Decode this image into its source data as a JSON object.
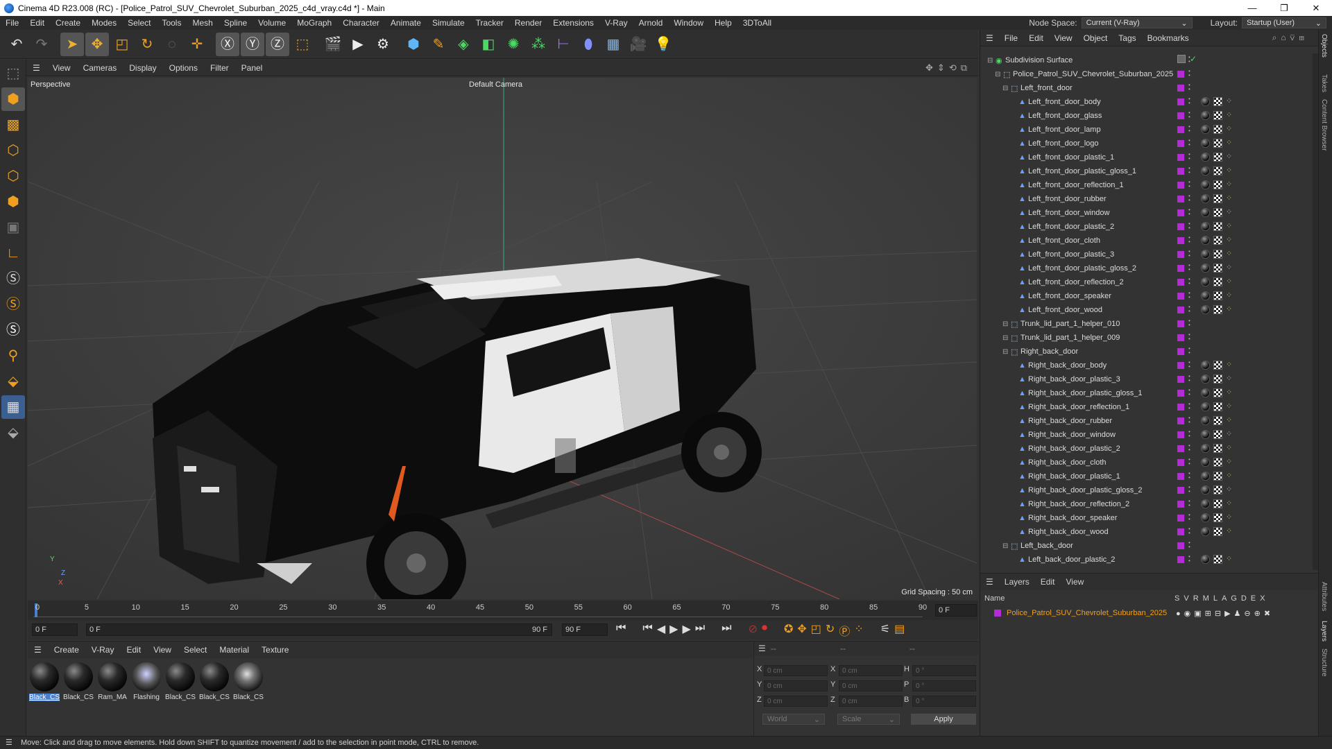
{
  "window": {
    "title": "Cinema 4D R23.008 (RC) - [Police_Patrol_SUV_Chevrolet_Suburban_2025_c4d_vray.c4d *] - Main",
    "minimize": "—",
    "maximize": "❐",
    "close": "✕"
  },
  "menubar": {
    "items": [
      "File",
      "Edit",
      "Create",
      "Modes",
      "Select",
      "Tools",
      "Mesh",
      "Spline",
      "Volume",
      "MoGraph",
      "Character",
      "Animate",
      "Simulate",
      "Tracker",
      "Render",
      "Extensions",
      "V-Ray",
      "Arnold",
      "Window",
      "Help",
      "3DToAll"
    ],
    "node_space_label": "Node Space:",
    "node_space_value": "Current (V-Ray)",
    "layout_label": "Layout:",
    "layout_value": "Startup (User)"
  },
  "viewport": {
    "menu": [
      "View",
      "Cameras",
      "Display",
      "Options",
      "Filter",
      "Panel"
    ],
    "view_name": "Perspective",
    "camera_name": "Default Camera",
    "grid_spacing": "Grid Spacing : 50 cm",
    "axis_y": "Y",
    "axis_z": "Z",
    "axis_x": "X"
  },
  "timeline": {
    "ticks": [
      "0",
      "5",
      "10",
      "15",
      "20",
      "25",
      "30",
      "35",
      "40",
      "45",
      "50",
      "55",
      "60",
      "65",
      "70",
      "75",
      "80",
      "85",
      "90"
    ],
    "current_frame": "0 F",
    "start_field": "0 F",
    "range_start": "0 F",
    "range_end": "90 F",
    "end_field": "90 F"
  },
  "materials": {
    "menu": [
      "Create",
      "V-Ray",
      "Edit",
      "View",
      "Select",
      "Material",
      "Texture"
    ],
    "items": [
      "Black_CS",
      "Black_CS",
      "Ram_MA",
      "Flashing",
      "Black_CS",
      "Black_CS",
      "Black_CS"
    ]
  },
  "coords": {
    "header": [
      "--",
      "--",
      "--"
    ],
    "rows": [
      {
        "a": "X",
        "av": "0 cm",
        "b": "X",
        "bv": "0 cm",
        "c": "H",
        "cv": "0 °"
      },
      {
        "a": "Y",
        "av": "0 cm",
        "b": "Y",
        "bv": "0 cm",
        "c": "P",
        "cv": "0 °"
      },
      {
        "a": "Z",
        "av": "0 cm",
        "b": "Z",
        "bv": "0 cm",
        "c": "B",
        "cv": "0 °"
      }
    ],
    "space": "World",
    "mode": "Scale",
    "apply": "Apply"
  },
  "objects": {
    "menu": [
      "File",
      "Edit",
      "View",
      "Object",
      "Tags",
      "Bookmarks"
    ],
    "rows": [
      {
        "name": "Subdivision Surface",
        "indent": 0,
        "tags": false
      },
      {
        "name": "Police_Patrol_SUV_Chevrolet_Suburban_2025",
        "indent": 1,
        "tags": false
      },
      {
        "name": "Left_front_door",
        "indent": 2,
        "tags": false
      },
      {
        "name": "Left_front_door_body",
        "indent": 3,
        "tags": true
      },
      {
        "name": "Left_front_door_glass",
        "indent": 3,
        "tags": true
      },
      {
        "name": "Left_front_door_lamp",
        "indent": 3,
        "tags": true
      },
      {
        "name": "Left_front_door_logo",
        "indent": 3,
        "tags": true
      },
      {
        "name": "Left_front_door_plastic_1",
        "indent": 3,
        "tags": true
      },
      {
        "name": "Left_front_door_plastic_gloss_1",
        "indent": 3,
        "tags": true
      },
      {
        "name": "Left_front_door_reflection_1",
        "indent": 3,
        "tags": true
      },
      {
        "name": "Left_front_door_rubber",
        "indent": 3,
        "tags": true
      },
      {
        "name": "Left_front_door_window",
        "indent": 3,
        "tags": true
      },
      {
        "name": "Left_front_door_plastic_2",
        "indent": 3,
        "tags": true
      },
      {
        "name": "Left_front_door_cloth",
        "indent": 3,
        "tags": true
      },
      {
        "name": "Left_front_door_plastic_3",
        "indent": 3,
        "tags": true
      },
      {
        "name": "Left_front_door_plastic_gloss_2",
        "indent": 3,
        "tags": true
      },
      {
        "name": "Left_front_door_reflection_2",
        "indent": 3,
        "tags": true
      },
      {
        "name": "Left_front_door_speaker",
        "indent": 3,
        "tags": true
      },
      {
        "name": "Left_front_door_wood",
        "indent": 3,
        "tags": true
      },
      {
        "name": "Trunk_lid_part_1_helper_010",
        "indent": 2,
        "tags": false
      },
      {
        "name": "Trunk_lid_part_1_helper_009",
        "indent": 2,
        "tags": false
      },
      {
        "name": "Right_back_door",
        "indent": 2,
        "tags": false
      },
      {
        "name": "Right_back_door_body",
        "indent": 3,
        "tags": true
      },
      {
        "name": "Right_back_door_plastic_3",
        "indent": 3,
        "tags": true
      },
      {
        "name": "Right_back_door_plastic_gloss_1",
        "indent": 3,
        "tags": true
      },
      {
        "name": "Right_back_door_reflection_1",
        "indent": 3,
        "tags": true
      },
      {
        "name": "Right_back_door_rubber",
        "indent": 3,
        "tags": true
      },
      {
        "name": "Right_back_door_window",
        "indent": 3,
        "tags": true
      },
      {
        "name": "Right_back_door_plastic_2",
        "indent": 3,
        "tags": true
      },
      {
        "name": "Right_back_door_cloth",
        "indent": 3,
        "tags": true
      },
      {
        "name": "Right_back_door_plastic_1",
        "indent": 3,
        "tags": true
      },
      {
        "name": "Right_back_door_plastic_gloss_2",
        "indent": 3,
        "tags": true
      },
      {
        "name": "Right_back_door_reflection_2",
        "indent": 3,
        "tags": true
      },
      {
        "name": "Right_back_door_speaker",
        "indent": 3,
        "tags": true
      },
      {
        "name": "Right_back_door_wood",
        "indent": 3,
        "tags": true
      },
      {
        "name": "Left_back_door",
        "indent": 2,
        "tags": false
      },
      {
        "name": "Left_back_door_plastic_2",
        "indent": 3,
        "tags": true
      }
    ]
  },
  "layers": {
    "menu": [
      "Layers",
      "Edit",
      "View"
    ],
    "col_name": "Name",
    "cols": [
      "S",
      "V",
      "R",
      "M",
      "L",
      "A",
      "G",
      "D",
      "E",
      "X"
    ],
    "row_name": "Police_Patrol_SUV_Chevrolet_Suburban_2025"
  },
  "side_tabs": [
    "Objects",
    "Takes",
    "Content Browser",
    "Attributes",
    "Layers",
    "Structure"
  ],
  "status": "Move: Click and drag to move elements. Hold down SHIFT to quantize movement / add to the selection in point mode, CTRL to remove.",
  "colors": {
    "accent": "#b52bd8",
    "layer_text": "#f0a020",
    "selection": "#4a7fd0"
  }
}
